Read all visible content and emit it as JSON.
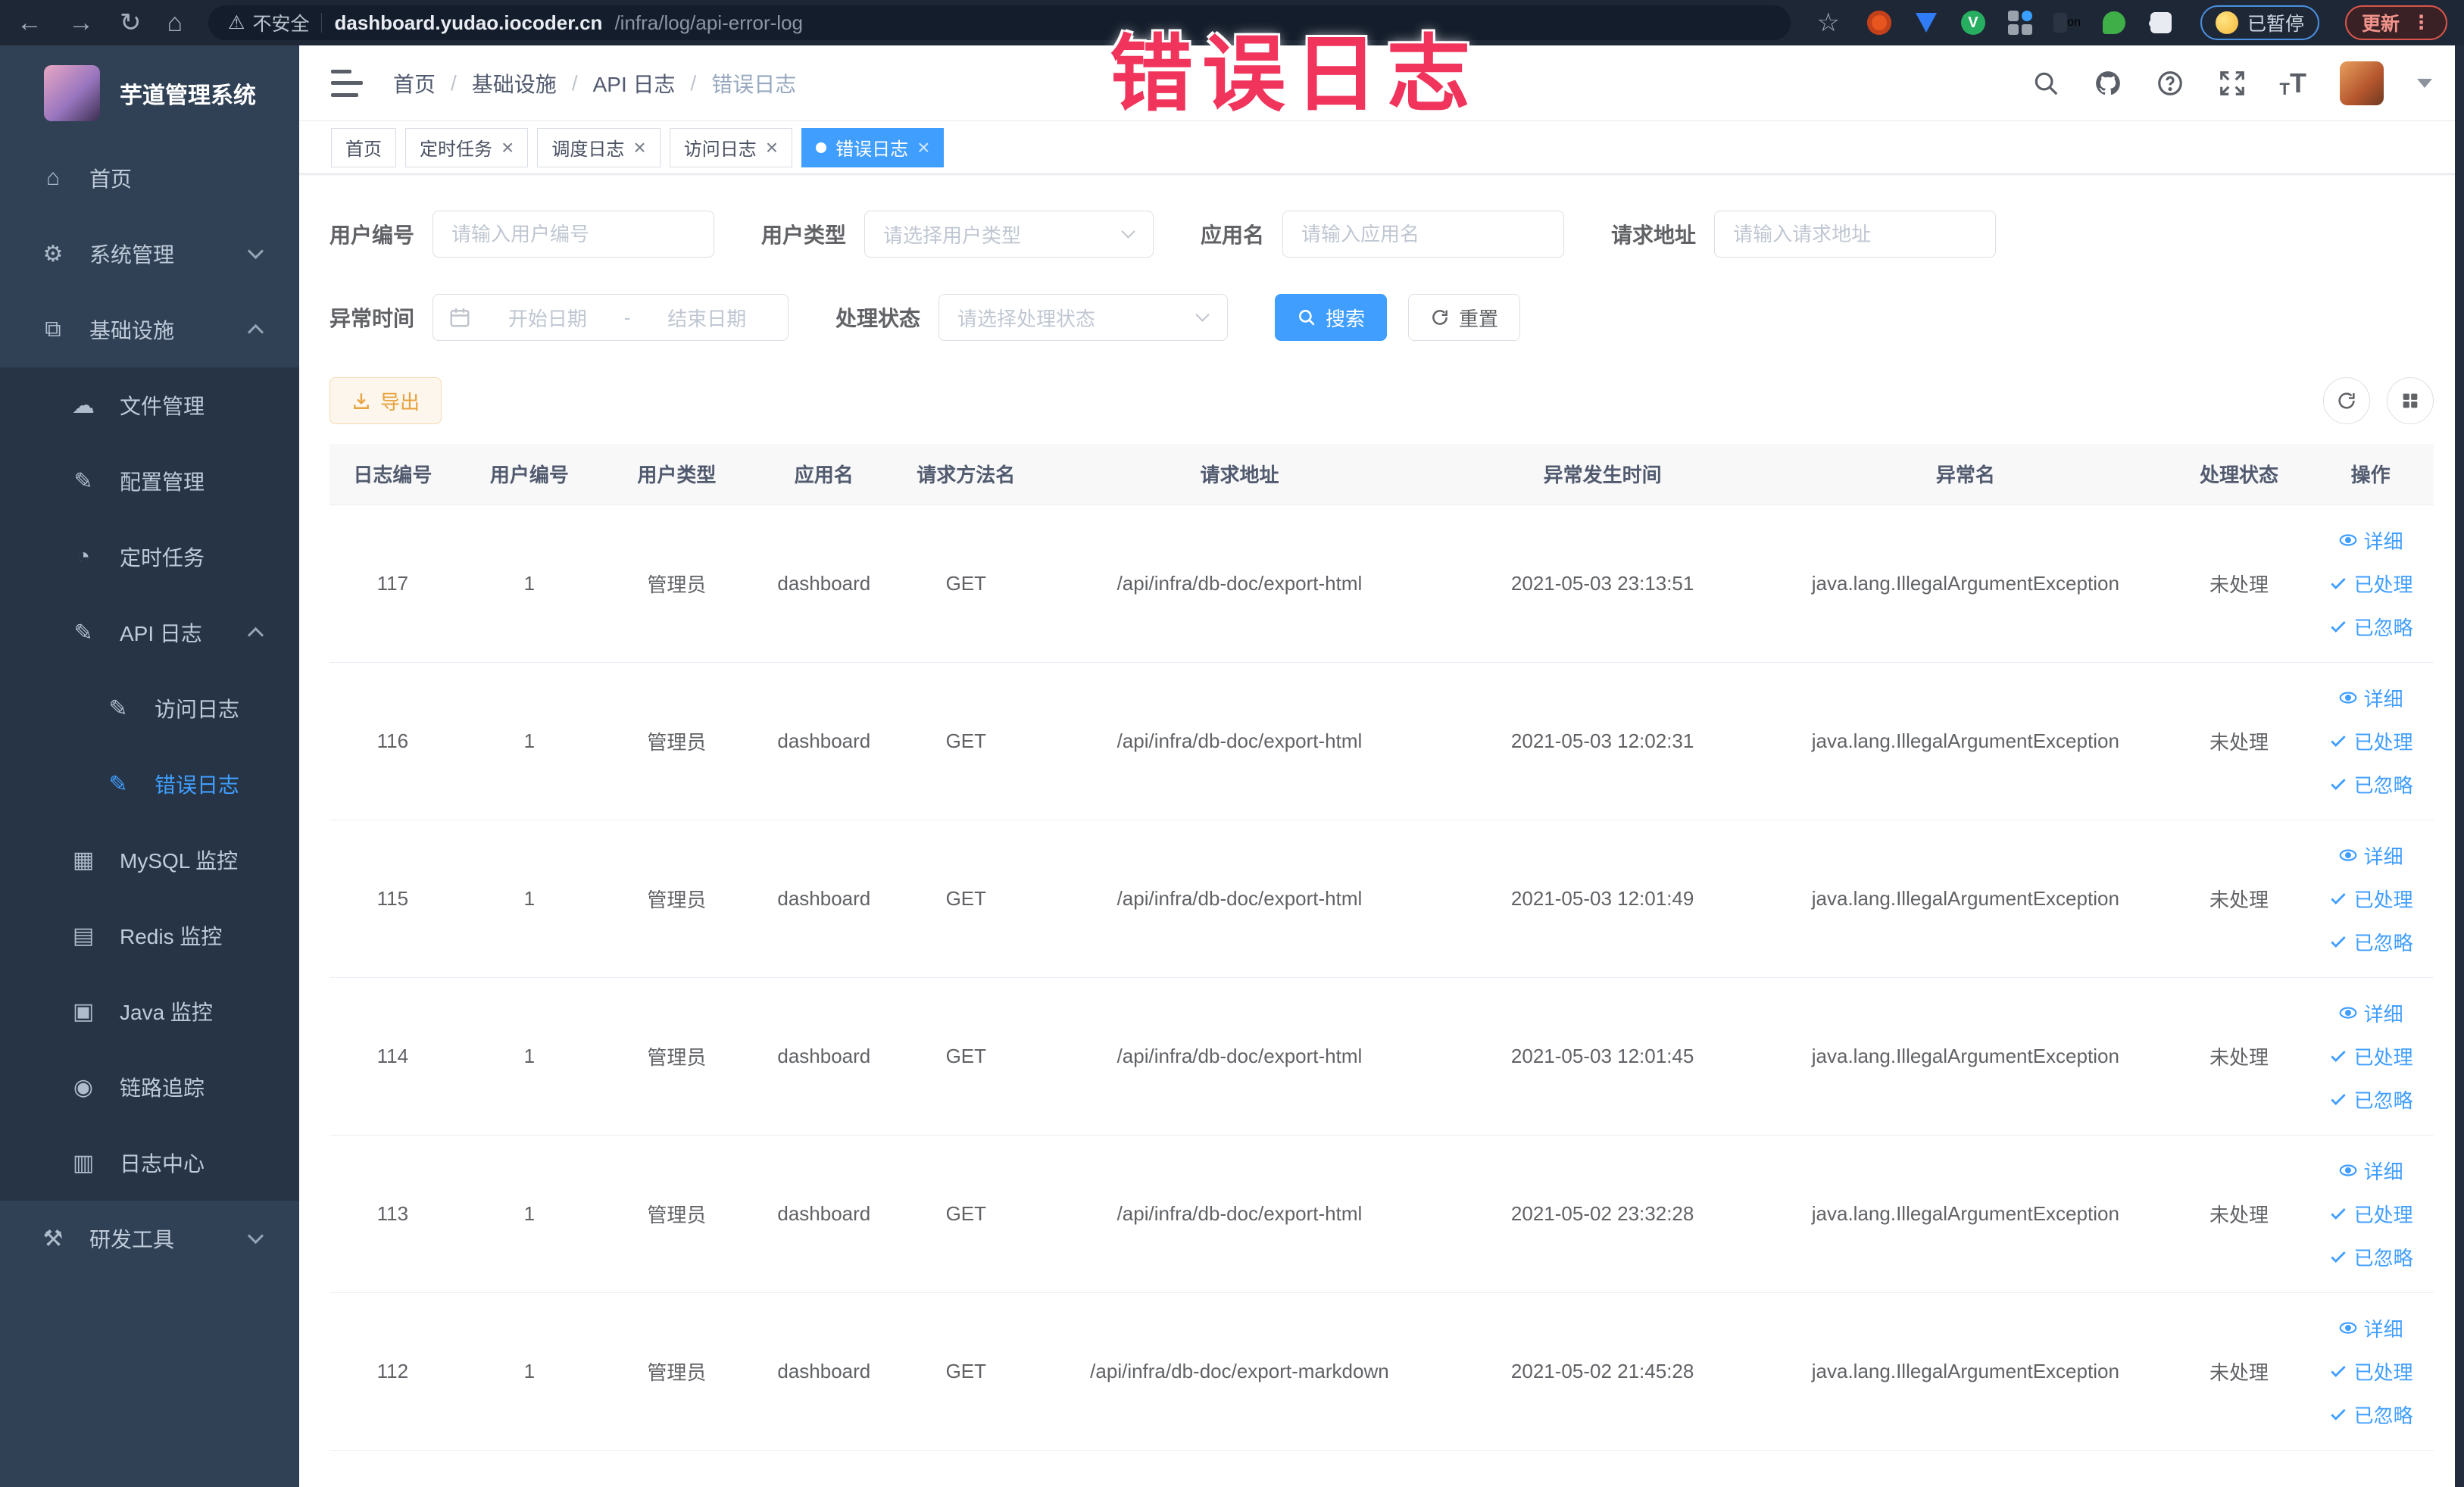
{
  "icons": {
    "back": "←",
    "forward": "→",
    "reload": "↻",
    "home": "⌂",
    "warning": "⚠",
    "star": "☆",
    "kebab": "⋮"
  },
  "browser": {
    "security_label": "不安全",
    "url_host": "dashboard.yudao.iocoder.cn",
    "url_path": "/infra/log/api-error-log",
    "extension_badge": "on",
    "profile_label": "已暂停",
    "update_label": "更新"
  },
  "annotation": {
    "text": "错误日志"
  },
  "sidebar": {
    "title": "芋道管理系统",
    "items": [
      {
        "id": "home",
        "label": "首页",
        "icon": "home-icon",
        "glyph": "⌂",
        "level": 1,
        "sub": false
      },
      {
        "id": "system-mgmt",
        "label": "系统管理",
        "icon": "gear-icon",
        "glyph": "⚙",
        "level": 1,
        "sub": false,
        "arrow": "down"
      },
      {
        "id": "infrastructure",
        "label": "基础设施",
        "icon": "monitor-icon",
        "glyph": "⧉",
        "level": 1,
        "sub": false,
        "arrow": "up"
      },
      {
        "id": "file-mgmt",
        "label": "文件管理",
        "icon": "cloud-upload-icon",
        "glyph": "☁",
        "level": 2,
        "sub": true
      },
      {
        "id": "config-mgmt",
        "label": "配置管理",
        "icon": "edit-icon",
        "glyph": "✎",
        "level": 2,
        "sub": true
      },
      {
        "id": "scheduled-jobs",
        "label": "定时任务",
        "icon": "timer-icon",
        "glyph": "◔",
        "level": 2,
        "sub": true
      },
      {
        "id": "api-log",
        "label": "API 日志",
        "icon": "log-edit-icon",
        "glyph": "✎",
        "level": 2,
        "sub": true,
        "arrow": "up"
      },
      {
        "id": "access-log",
        "label": "访问日志",
        "icon": "log-edit-icon",
        "glyph": "✎",
        "level": 3,
        "sub": true
      },
      {
        "id": "error-log",
        "label": "错误日志",
        "icon": "log-edit-icon",
        "glyph": "✎",
        "level": 3,
        "sub": true,
        "active": true
      },
      {
        "id": "mysql-monitor",
        "label": "MySQL 监控",
        "icon": "mysql-icon",
        "glyph": "▦",
        "level": 2,
        "sub": true
      },
      {
        "id": "redis-monitor",
        "label": "Redis 监控",
        "icon": "redis-icon",
        "glyph": "▤",
        "level": 2,
        "sub": true
      },
      {
        "id": "java-monitor",
        "label": "Java 监控",
        "icon": "java-icon",
        "glyph": "▣",
        "level": 2,
        "sub": true
      },
      {
        "id": "tracing",
        "label": "链路追踪",
        "icon": "eye-icon",
        "glyph": "◉",
        "level": 2,
        "sub": true
      },
      {
        "id": "log-center",
        "label": "日志中心",
        "icon": "log-doc-icon",
        "glyph": "▥",
        "level": 2,
        "sub": true
      },
      {
        "id": "dev-tools",
        "label": "研发工具",
        "icon": "tools-icon",
        "glyph": "⚒",
        "level": 1,
        "sub": false,
        "arrow": "down"
      }
    ]
  },
  "breadcrumb": {
    "items": [
      "首页",
      "基础设施",
      "API 日志",
      "错误日志"
    ]
  },
  "tabs": {
    "items": [
      {
        "label": "首页",
        "closable": false,
        "active": false
      },
      {
        "label": "定时任务",
        "closable": true,
        "active": false
      },
      {
        "label": "调度日志",
        "closable": true,
        "active": false
      },
      {
        "label": "访问日志",
        "closable": true,
        "active": false
      },
      {
        "label": "错误日志",
        "closable": true,
        "active": true
      }
    ]
  },
  "filters": {
    "user_id": {
      "label": "用户编号",
      "placeholder": "请输入用户编号"
    },
    "user_type": {
      "label": "用户类型",
      "placeholder": "请选择用户类型"
    },
    "app_name": {
      "label": "应用名",
      "placeholder": "请输入应用名"
    },
    "request_url": {
      "label": "请求地址",
      "placeholder": "请输入请求地址"
    },
    "exception_time": {
      "label": "异常时间",
      "start_placeholder": "开始日期",
      "separator": "-",
      "end_placeholder": "结束日期"
    },
    "process_status": {
      "label": "处理状态",
      "placeholder": "请选择处理状态"
    },
    "search_label": "搜索",
    "reset_label": "重置"
  },
  "toolbar": {
    "export_label": "导出"
  },
  "table": {
    "headers": [
      "日志编号",
      "用户编号",
      "用户类型",
      "应用名",
      "请求方法名",
      "请求地址",
      "异常发生时间",
      "异常名",
      "处理状态",
      "操作"
    ],
    "row_keys": [
      "id",
      "user_id",
      "user_type",
      "app",
      "method",
      "url",
      "time",
      "exception",
      "status"
    ],
    "actions": [
      {
        "name": "detail",
        "label": "详细",
        "icon": "view"
      },
      {
        "name": "processed",
        "label": "已处理",
        "icon": "check"
      },
      {
        "name": "ignored",
        "label": "已忽略",
        "icon": "check"
      }
    ],
    "rows": [
      {
        "id": "117",
        "user_id": "1",
        "user_type": "管理员",
        "app": "dashboard",
        "method": "GET",
        "url": "/api/infra/db-doc/export-html",
        "time": "2021-05-03 23:13:51",
        "exception": "java.lang.IllegalArgumentException",
        "status": "未处理"
      },
      {
        "id": "116",
        "user_id": "1",
        "user_type": "管理员",
        "app": "dashboard",
        "method": "GET",
        "url": "/api/infra/db-doc/export-html",
        "time": "2021-05-03 12:02:31",
        "exception": "java.lang.IllegalArgumentException",
        "status": "未处理"
      },
      {
        "id": "115",
        "user_id": "1",
        "user_type": "管理员",
        "app": "dashboard",
        "method": "GET",
        "url": "/api/infra/db-doc/export-html",
        "time": "2021-05-03 12:01:49",
        "exception": "java.lang.IllegalArgumentException",
        "status": "未处理"
      },
      {
        "id": "114",
        "user_id": "1",
        "user_type": "管理员",
        "app": "dashboard",
        "method": "GET",
        "url": "/api/infra/db-doc/export-html",
        "time": "2021-05-03 12:01:45",
        "exception": "java.lang.IllegalArgumentException",
        "status": "未处理"
      },
      {
        "id": "113",
        "user_id": "1",
        "user_type": "管理员",
        "app": "dashboard",
        "method": "GET",
        "url": "/api/infra/db-doc/export-html",
        "time": "2021-05-02 23:32:28",
        "exception": "java.lang.IllegalArgumentException",
        "status": "未处理"
      },
      {
        "id": "112",
        "user_id": "1",
        "user_type": "管理员",
        "app": "dashboard",
        "method": "GET",
        "url": "/api/infra/db-doc/export-markdown",
        "time": "2021-05-02 21:45:28",
        "exception": "java.lang.IllegalArgumentException",
        "status": "未处理"
      }
    ]
  },
  "colors": {
    "accent": "#409eff",
    "warning": "#e6a23c",
    "annotation": "#f0345c",
    "sidebar_bg": "#304156",
    "submenu_bg": "#263445"
  }
}
